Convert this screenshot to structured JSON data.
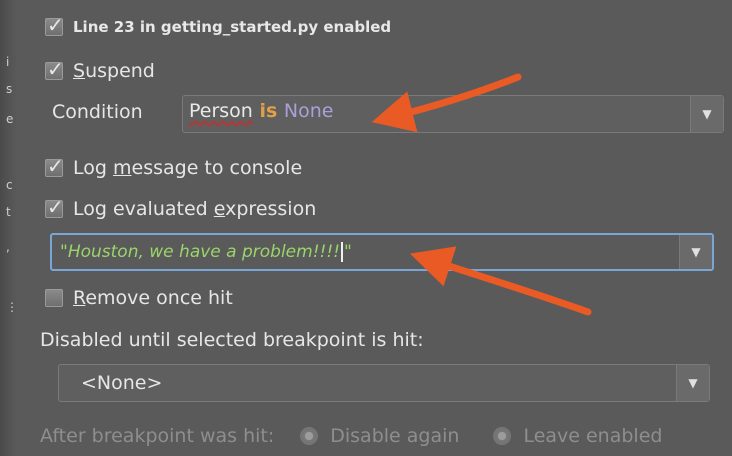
{
  "header": {
    "label": "Line 23 in getting_started.py enabled",
    "checked": true
  },
  "suspend": {
    "label_prefix": "S",
    "label_rest": "uspend",
    "checked": true
  },
  "condition": {
    "label": "Condition",
    "tokens": [
      "Person",
      " is ",
      "None"
    ],
    "token_colors": {
      "name": "#e9e9e9",
      "keyword": "#e0a04a",
      "constant": "#a9a0d8"
    }
  },
  "log_message": {
    "label_a": "Log ",
    "label_u": "m",
    "label_b": "essage to console",
    "checked": true
  },
  "log_expression": {
    "label_a": "Log evaluated ",
    "label_u": "e",
    "label_b": "xpression",
    "checked": true
  },
  "expression": {
    "value_before_caret": "\"Houston, we have a problem!!!!",
    "value_after_caret": "\""
  },
  "remove_once_hit": {
    "label_u": "R",
    "label_rest": "emove once hit",
    "checked": false
  },
  "disabled_until": {
    "label": "Disabled until selected breakpoint is hit:",
    "selected": "<None>"
  },
  "after_hit": {
    "label": "After breakpoint was hit:",
    "options": [
      "Disable again",
      "Leave enabled"
    ]
  },
  "icons": {
    "dropdown": "chevron-down-icon",
    "check": "check-icon"
  },
  "colors": {
    "focus": "#79a6d6",
    "annotation_arrow": "#ea5a25",
    "expression_text": "#9ad46a"
  }
}
